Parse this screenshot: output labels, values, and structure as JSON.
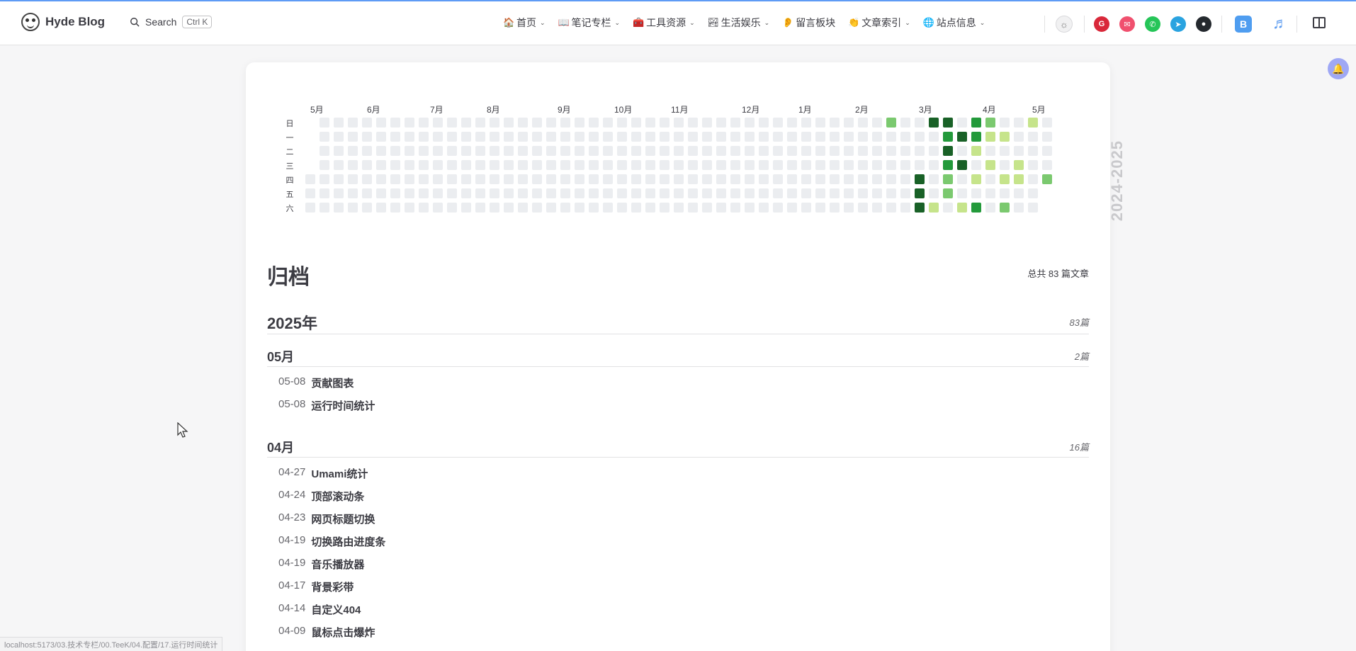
{
  "brand": {
    "title": "Hyde Blog"
  },
  "search": {
    "label": "Search",
    "shortcut": "Ctrl K"
  },
  "nav": [
    {
      "emoji": "🏠",
      "label": "首页",
      "dropdown": true
    },
    {
      "emoji": "📖",
      "label": "笔记专栏",
      "dropdown": true
    },
    {
      "emoji": "🧰",
      "label": "工具资源",
      "dropdown": true
    },
    {
      "emoji": "🏞",
      "label": "生活娱乐",
      "dropdown": true
    },
    {
      "emoji": "👂",
      "label": "留言板块",
      "dropdown": false
    },
    {
      "emoji": "👏",
      "label": "文章索引",
      "dropdown": true
    },
    {
      "emoji": "🌐",
      "label": "站点信息",
      "dropdown": true
    }
  ],
  "toolbar": {
    "b_label": "B"
  },
  "heatmap": {
    "year_range": "2024-2025",
    "months": [
      "5月",
      "6月",
      "7月",
      "8月",
      "9月",
      "10月",
      "11月",
      "12月",
      "1月",
      "2月",
      "3月",
      "4月",
      "5月"
    ],
    "weekdays": [
      "日",
      "一",
      "二",
      "三",
      "四",
      "五",
      "六"
    ],
    "colors": [
      "#ebedf0",
      "#c6e48b",
      "#7bc96f",
      "#239a3b",
      "#196127"
    ],
    "levels": "0=empty,1..4 intensity"
  },
  "archive": {
    "title": "归档",
    "total": "总共 83 篇文章",
    "year": "2025年",
    "year_count": "83篇",
    "months": [
      {
        "name": "05月",
        "count": "2篇",
        "posts": [
          {
            "date": "05-08",
            "title": "贡献图表"
          },
          {
            "date": "05-08",
            "title": "运行时间统计"
          }
        ]
      },
      {
        "name": "04月",
        "count": "16篇",
        "posts": [
          {
            "date": "04-27",
            "title": "Umami统计"
          },
          {
            "date": "04-24",
            "title": "顶部滚动条"
          },
          {
            "date": "04-23",
            "title": "网页标题切换"
          },
          {
            "date": "04-19",
            "title": "切换路由进度条"
          },
          {
            "date": "04-19",
            "title": "音乐播放器"
          },
          {
            "date": "04-17",
            "title": "背景彩带"
          },
          {
            "date": "04-14",
            "title": "自定义404"
          },
          {
            "date": "04-09",
            "title": "鼠标点击爆炸"
          }
        ]
      }
    ]
  },
  "status": {
    "url": "localhost:5173/03.技术专栏/00.TeeK/04.配置/17.运行时间统计"
  }
}
